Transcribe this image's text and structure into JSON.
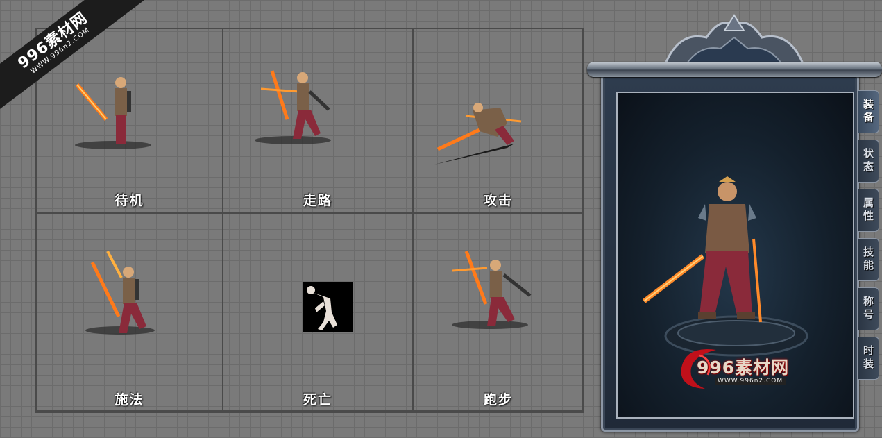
{
  "watermark": {
    "site": "996素材网",
    "url": "WWW.996n2.COM"
  },
  "actions": [
    {
      "label": "待机"
    },
    {
      "label": "走路"
    },
    {
      "label": "攻击"
    },
    {
      "label": "施法"
    },
    {
      "label": "死亡"
    },
    {
      "label": "跑步"
    }
  ],
  "panel": {
    "tabs": [
      "装备",
      "状态",
      "属性",
      "技能",
      "称号",
      "时装"
    ],
    "active_tab": "装备",
    "logo_text": "996素材网",
    "logo_url": "WWW.996n2.COM"
  },
  "colors": {
    "background": "#7a7a7a",
    "grid_border": "#4a4a4a",
    "panel_frame": "#2e3c4e",
    "label": "#ffffff"
  }
}
